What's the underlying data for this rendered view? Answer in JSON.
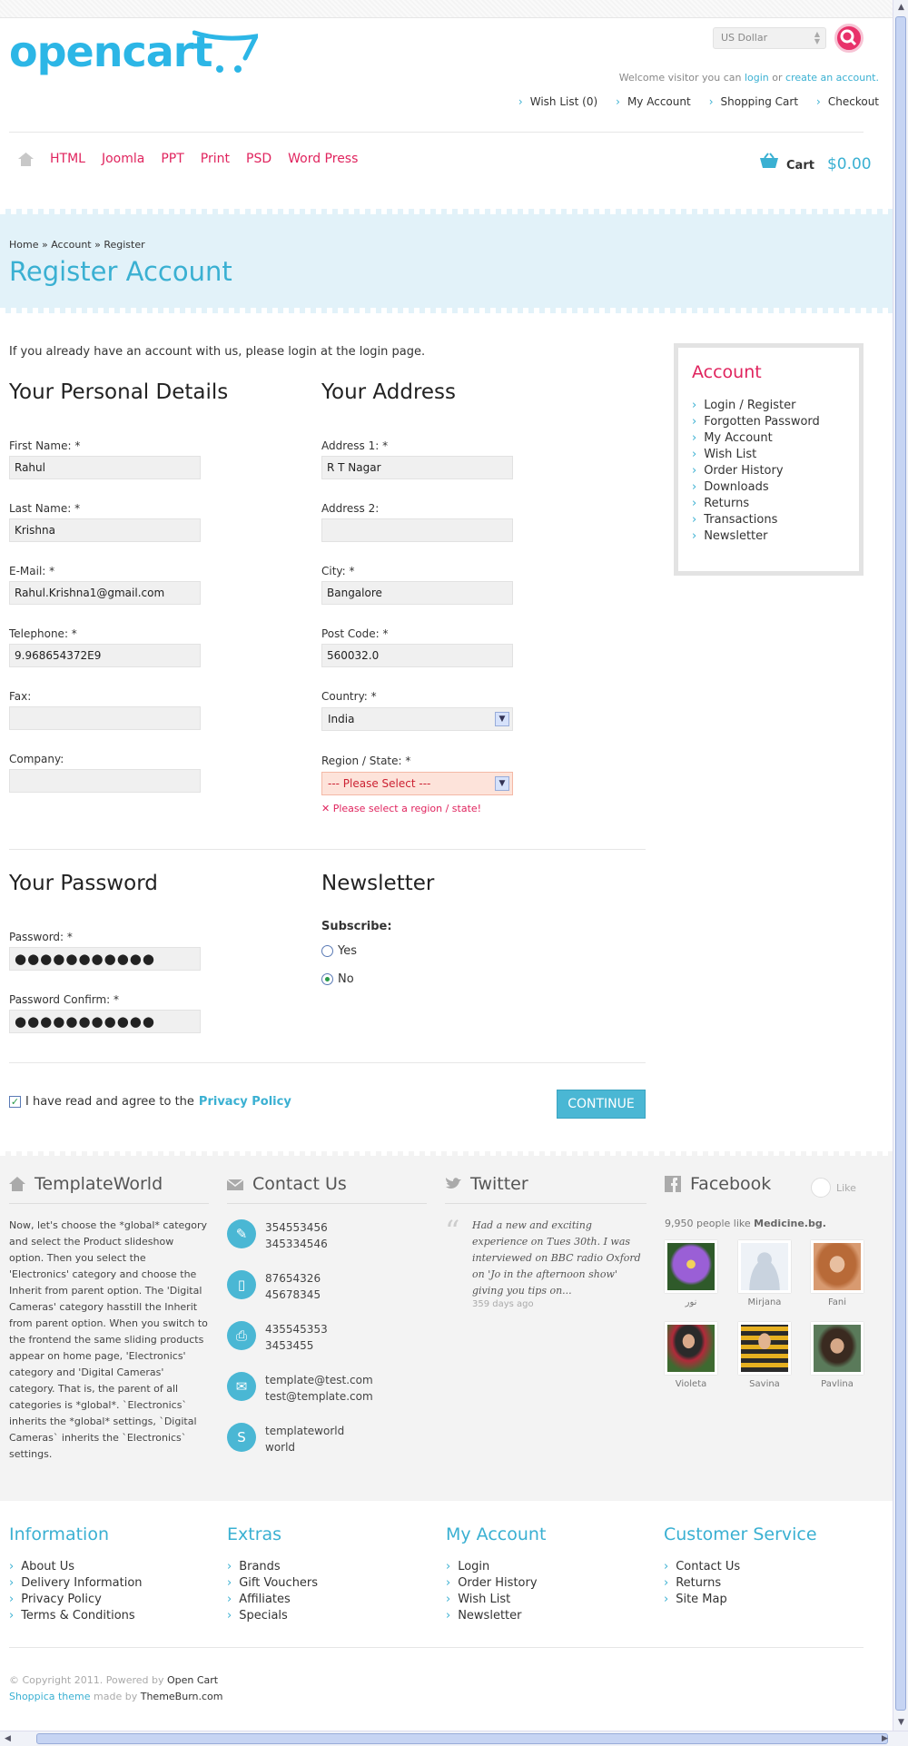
{
  "header": {
    "logo": "opencart",
    "currency": "US Dollar",
    "welcome_prefix": "Welcome visitor you can",
    "login_link": "login",
    "or": "or",
    "create_link": "create an account.",
    "top_links": [
      "Wish List (0)",
      "My Account",
      "Shopping Cart",
      "Checkout"
    ],
    "nav": [
      "HTML",
      "Joomla",
      "PPT",
      "Print",
      "PSD",
      "Word Press"
    ],
    "cart_label": "Cart",
    "cart_amount": "$0.00"
  },
  "breadcrumb": "Home » Account » Register",
  "page_title": "Register Account",
  "intro": "If you already have an account with us, please login at the login page.",
  "personal": {
    "title": "Your Personal Details",
    "first_name_label": "First Name: *",
    "first_name": "Rahul",
    "last_name_label": "Last Name: *",
    "last_name": "Krishna",
    "email_label": "E-Mail: *",
    "email": "Rahul.Krishna1@gmail.com",
    "telephone_label": "Telephone: *",
    "telephone": "9.968654372E9",
    "fax_label": "Fax:",
    "fax": "",
    "company_label": "Company:",
    "company": ""
  },
  "address": {
    "title": "Your Address",
    "address1_label": "Address 1: *",
    "address1": "R T Nagar",
    "address2_label": "Address 2:",
    "address2": "",
    "city_label": "City: *",
    "city": "Bangalore",
    "postcode_label": "Post Code: *",
    "postcode": "560032.0",
    "country_label": "Country: *",
    "country": "India",
    "region_label": "Region / State: *",
    "region": "--- Please Select ---",
    "region_error": "✕ Please select a region / state!"
  },
  "password": {
    "title": "Your Password",
    "password_label": "Password: *",
    "password": "●●●●●●●●●●●",
    "confirm_label": "Password Confirm: *",
    "confirm": "●●●●●●●●●●●"
  },
  "newsletter": {
    "title": "Newsletter",
    "subscribe_label": "Subscribe:",
    "yes": "Yes",
    "no": "No",
    "selected": "No"
  },
  "agree": {
    "text": "I have read and agree to the",
    "link": "Privacy Policy",
    "checked": true
  },
  "continue_label": "CONTINUE",
  "sidebar": {
    "title": "Account",
    "items": [
      "Login / Register",
      "Forgotten Password",
      "My Account",
      "Wish List",
      "Order History",
      "Downloads",
      "Returns",
      "Transactions",
      "Newsletter"
    ]
  },
  "footer_top": {
    "templateworld": {
      "title": "TemplateWorld",
      "text": "Now, let's choose the *global* category and select the Product slideshow option. Then you select the 'Electronics' category and choose the Inherit from parent option. The 'Digital Cameras' category hasstill the Inherit from parent option. When you switch to the frontend the same sliding products appear on home page, 'Electronics' category and 'Digital Cameras' category. That is, the parent of all categories is *global*. `Electronics` inherits the *global* settings, `Digital Cameras` inherits the `Electronics` settings."
    },
    "contact": {
      "title": "Contact Us",
      "items": [
        {
          "icon": "wrench-icon",
          "line1": "354553456",
          "line2": "345334546"
        },
        {
          "icon": "mobile-icon",
          "line1": "87654326",
          "line2": "45678345"
        },
        {
          "icon": "fax-icon",
          "line1": "435545353",
          "line2": "3453455"
        },
        {
          "icon": "mail-icon",
          "line1": "template@test.com",
          "line2": "test@template.com"
        },
        {
          "icon": "skype-icon",
          "line1": "templateworld",
          "line2": "world"
        }
      ]
    },
    "twitter": {
      "title": "Twitter",
      "tweet": "Had a new and exciting experience on Tues 30th. I was interviewed on BBC radio Oxford on 'Jo in the afternoon show' giving you tips on...",
      "ago": "359 days ago"
    },
    "facebook": {
      "title": "Facebook",
      "like": "Like",
      "people": "9,950 people like",
      "page": "Medicine.bg.",
      "fans": [
        "ﻧﻮﺭ",
        "Mirjana",
        "Fani",
        "Violeta",
        "Savina",
        "Pavlina"
      ]
    }
  },
  "footer_bottom": {
    "columns": [
      {
        "title": "Information",
        "items": [
          "About Us",
          "Delivery Information",
          "Privacy Policy",
          "Terms & Conditions"
        ]
      },
      {
        "title": "Extras",
        "items": [
          "Brands",
          "Gift Vouchers",
          "Affiliates",
          "Specials"
        ]
      },
      {
        "title": "My Account",
        "items": [
          "Login",
          "Order History",
          "Wish List",
          "Newsletter"
        ]
      },
      {
        "title": "Customer Service",
        "items": [
          "Contact Us",
          "Returns",
          "Site Map"
        ]
      }
    ],
    "copyright_prefix": "© Copyright 2011. Powered by",
    "powered": "Open Cart",
    "theme": "Shoppica theme",
    "made_by": "made by",
    "maker": "ThemeBurn.com"
  },
  "colors": {
    "accent_blue": "#3ab0d2",
    "accent_pink": "#e0245e"
  }
}
